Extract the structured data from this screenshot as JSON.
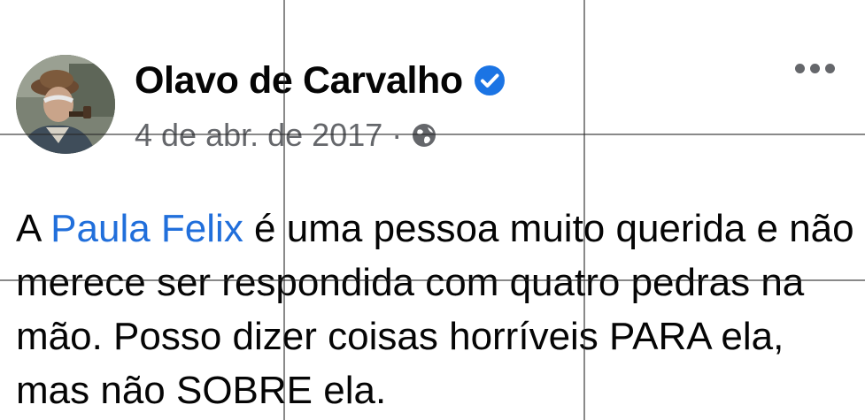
{
  "post": {
    "author": "Olavo de Carvalho",
    "date": "4 de abr. de 2017",
    "separator": "·",
    "privacy_icon": "globe-icon",
    "verified_icon": "verified-badge-icon",
    "more_icon": "more-options-icon",
    "text_before_mention": "A ",
    "mention": "Paula Felix",
    "text_after_mention": " é uma pessoa muito querida e não merece ser respondida com quatro pedras na mão. Posso dizer coisas horríveis PARA ela, mas não SOBRE ela."
  },
  "colors": {
    "text": "#050505",
    "meta": "#65676b",
    "mention": "#216fdb",
    "verified": "#1b74e4"
  }
}
